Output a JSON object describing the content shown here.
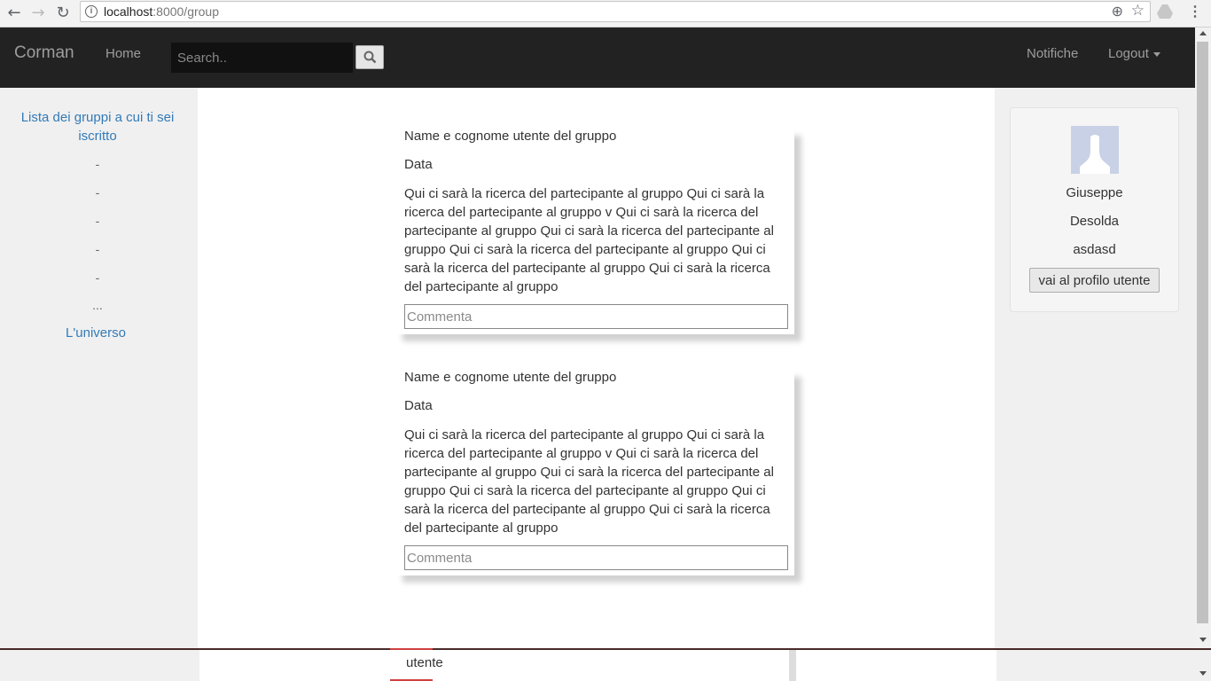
{
  "browser": {
    "url_host": "localhost",
    "url_rest": ":8000/group"
  },
  "navbar": {
    "brand": "Corman",
    "home": "Home",
    "search_placeholder": "Search..",
    "notifications": "Notifiche",
    "logout": "Logout"
  },
  "left_sidebar": {
    "title": "Lista dei gruppi a cui ti sei iscritto",
    "items": [
      "-",
      "-",
      "-",
      "-",
      "-"
    ],
    "more": "...",
    "universe": "L'universo"
  },
  "posts": [
    {
      "author": "Name e cognome utente del gruppo",
      "date": "Data",
      "body": "Qui ci sarà la ricerca del partecipante al gruppo Qui ci sarà la ricerca del partecipante al gruppo v Qui ci sarà la ricerca del partecipante al gruppo Qui ci sarà la ricerca del partecipante al gruppo Qui ci sarà la ricerca del partecipante al gruppo Qui ci sarà la ricerca del partecipante al gruppo Qui ci sarà la ricerca del partecipante al gruppo",
      "comment_placeholder": "Commenta"
    },
    {
      "author": "Name e cognome utente del gruppo",
      "date": "Data",
      "body": "Qui ci sarà la ricerca del partecipante al gruppo Qui ci sarà la ricerca del partecipante al gruppo v Qui ci sarà la ricerca del partecipante al gruppo Qui ci sarà la ricerca del partecipante al gruppo Qui ci sarà la ricerca del partecipante al gruppo Qui ci sarà la ricerca del partecipante al gruppo Qui ci sarà la ricerca del partecipante al gruppo",
      "comment_placeholder": "Commenta"
    }
  ],
  "profile": {
    "first_name": "Giuseppe",
    "last_name": "Desolda",
    "extra": "asdasd",
    "button": "vai al profilo utente"
  },
  "bottom_overlay": {
    "label": "utente"
  },
  "colors": {
    "navbar_bg": "#222222",
    "link": "#337ab7",
    "sidebar_bg": "#f0f0f0"
  }
}
